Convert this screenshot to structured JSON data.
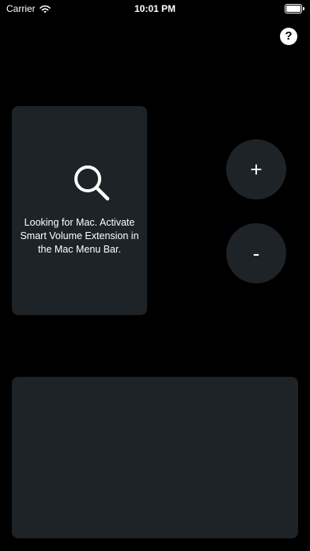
{
  "status_bar": {
    "carrier": "Carrier",
    "time": "10:01 PM",
    "wifi_icon": "wifi-icon",
    "battery_icon": "battery-icon"
  },
  "header": {
    "help_label": "?",
    "help_icon": "help-icon"
  },
  "status_card": {
    "icon": "search-icon",
    "message": "Looking for Mac. Activate Smart Volume Extension in the Mac Menu Bar."
  },
  "controls": {
    "volume_up_label": "+",
    "volume_down_label": "-"
  },
  "colors": {
    "background": "#000000",
    "surface": "#1e2327",
    "text": "#ffffff"
  }
}
